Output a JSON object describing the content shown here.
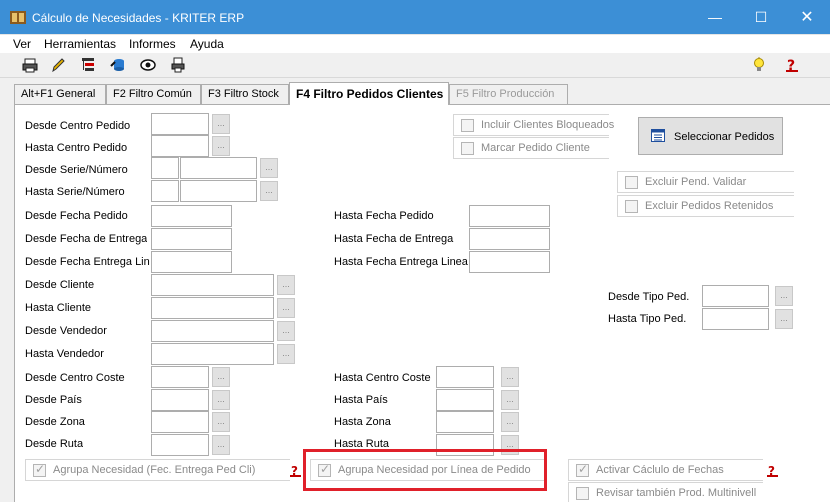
{
  "window": {
    "title": "Cálculo de Necesidades - KRITER ERP",
    "min_symbol": "—",
    "max_symbol": "☐",
    "close_symbol": "✕"
  },
  "menu": [
    "Ver",
    "Herramientas",
    "Informes",
    "Ayuda"
  ],
  "toolbar_icons": [
    "printer-icon",
    "pencil-icon",
    "tree-icon",
    "db-icon",
    "eye-icon",
    "preview-icon"
  ],
  "tabs": [
    {
      "label": "Alt+F1 General",
      "state": "normal"
    },
    {
      "label": "F2 Filtro Común",
      "state": "normal"
    },
    {
      "label": "F3 Filtro Stock",
      "state": "normal"
    },
    {
      "label": "F4 Filtro Pedidos Clientes",
      "state": "active"
    },
    {
      "label": "F5 Filtro Producción",
      "state": "disabled"
    }
  ],
  "left_labels": [
    "Desde Centro Pedido",
    "Hasta Centro Pedido",
    "Desde Serie/Número",
    "Hasta Serie/Número",
    "Desde Fecha Pedido",
    "Desde Fecha de Entrega",
    "Desde Fecha Entrega Linea",
    "Desde Cliente",
    "Hasta Cliente",
    "Desde Vendedor",
    "Hasta Vendedor",
    "Desde Centro Coste",
    "Desde País",
    "Desde Zona",
    "Desde Ruta"
  ],
  "mid_labels": [
    "Hasta Fecha Pedido",
    "Hasta Fecha de Entrega",
    "Hasta Fecha Entrega Linea",
    "Hasta Centro Coste",
    "Hasta País",
    "Hasta Zona",
    "Hasta Ruta"
  ],
  "right_labels": [
    "Desde Tipo Ped.",
    "Hasta Tipo Ped."
  ],
  "dots_label": "...",
  "checkboxes": {
    "incluir_bloqueados": {
      "label": "Incluir Clientes Bloqueados",
      "checked": false
    },
    "marcar_pedido": {
      "label": "Marcar Pedido Cliente",
      "checked": false
    },
    "excluir_pend": {
      "label": "Excluir  Pend. Validar",
      "checked": false
    },
    "excluir_retenidos": {
      "label": "Excluir Pedidos Retenidos",
      "checked": false
    },
    "agrupa_fec": {
      "label": "Agrupa Necesidad (Fec. Entrega Ped Cli)",
      "checked": true
    },
    "agrupa_linea": {
      "label": "Agrupa Necesidad por Línea de Pedido",
      "checked": true
    },
    "activar_fechas": {
      "label": "Activar Cáclulo de Fechas",
      "checked": true
    },
    "revisar_multinivell": {
      "label": "Revisar también Prod. Multinivell",
      "checked": false
    }
  },
  "select_button": "Seleccionar Pedidos",
  "colors": {
    "title_bar": "#3c8fd6",
    "highlight": "#e0202a",
    "help_icon": "#c00000"
  }
}
